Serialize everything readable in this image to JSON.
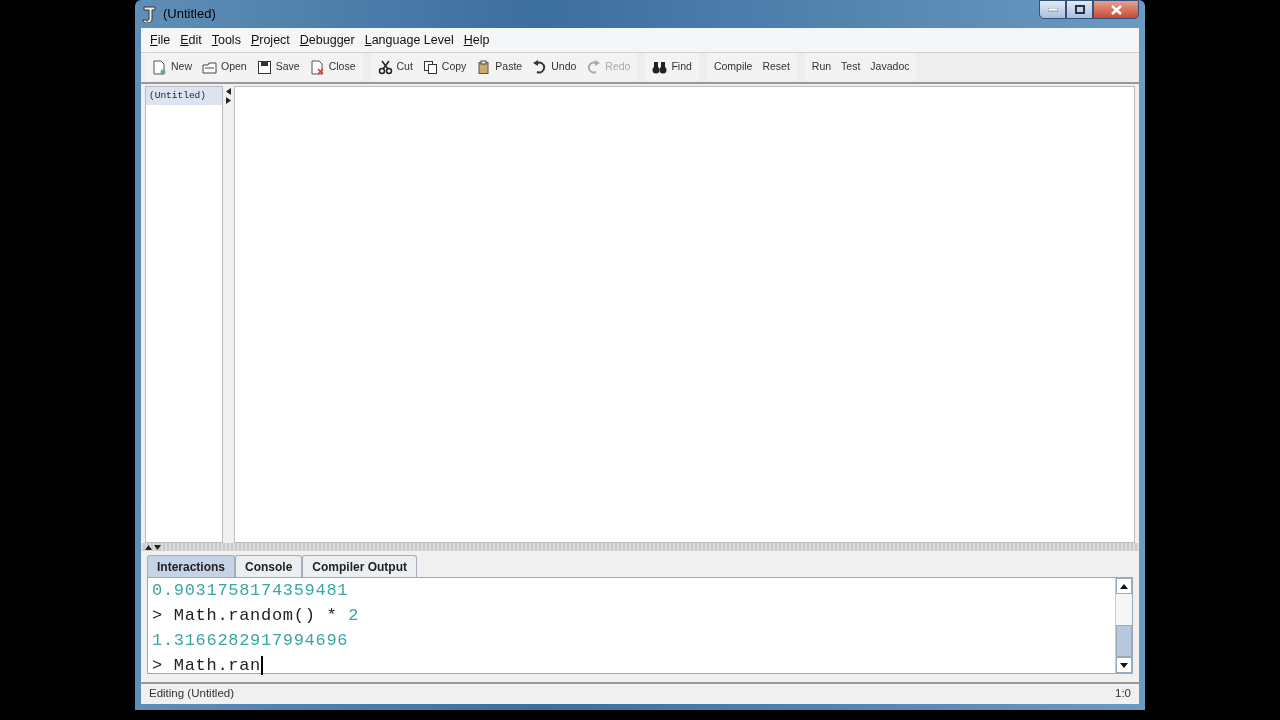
{
  "window": {
    "title": "(Untitled)"
  },
  "menu": [
    {
      "label": "File",
      "initial_underlined": true
    },
    {
      "label": "Edit",
      "initial_underlined": true
    },
    {
      "label": "Tools",
      "initial_underlined": true
    },
    {
      "label": "Project",
      "initial_underlined": true
    },
    {
      "label": "Debugger",
      "initial_underlined": true
    },
    {
      "label": "Language Level",
      "initial_underlined": true
    },
    {
      "label": "Help",
      "initial_underlined": true
    }
  ],
  "toolbar": [
    [
      {
        "label": "New",
        "disabled": false
      },
      {
        "label": "Open",
        "disabled": false
      },
      {
        "label": "Save",
        "disabled": false
      },
      {
        "label": "Close",
        "disabled": false
      }
    ],
    [
      {
        "label": "Cut",
        "disabled": false
      },
      {
        "label": "Copy",
        "disabled": false
      },
      {
        "label": "Paste",
        "disabled": false
      },
      {
        "label": "Undo",
        "disabled": false
      },
      {
        "label": "Redo",
        "disabled": true
      }
    ],
    [
      {
        "label": "Find",
        "disabled": false
      }
    ],
    [
      {
        "label": "Compile",
        "disabled": false
      },
      {
        "label": "Reset",
        "disabled": false
      }
    ],
    [
      {
        "label": "Run",
        "disabled": false
      },
      {
        "label": "Test",
        "disabled": false
      },
      {
        "label": "Javadoc",
        "disabled": false
      }
    ]
  ],
  "documents": [
    {
      "label": "(Untitled)",
      "selected": true
    }
  ],
  "tabs": [
    {
      "label": "Interactions",
      "selected": true
    },
    {
      "label": "Console",
      "selected": false
    },
    {
      "label": "Compiler Output",
      "selected": false
    }
  ],
  "interactions": [
    {
      "kind": "output",
      "text": "0.9031758174359481"
    },
    {
      "kind": "input",
      "prompt": ">",
      "parts": [
        {
          "kind": "code",
          "text": "Math.random() *"
        },
        {
          "kind": "number",
          "text": "2"
        }
      ]
    },
    {
      "kind": "output",
      "text": "1.3166282917994696"
    },
    {
      "kind": "input",
      "prompt": ">",
      "parts": [
        {
          "kind": "code",
          "text": "Math.ran"
        }
      ],
      "caret": true
    }
  ],
  "status_bar": {
    "message": "Editing (Untitled)",
    "position": "1:0"
  }
}
